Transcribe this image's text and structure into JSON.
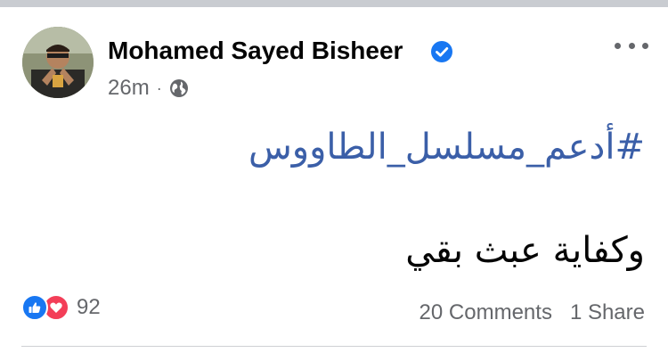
{
  "post": {
    "author": "Mohamed Sayed Bisheer",
    "time": "26m",
    "separator": "·",
    "privacy_icon": "globe-icon",
    "verified_icon": "verified-badge-icon",
    "hashtag": "#أدعم_مسلسل_الطاووس",
    "body_text": "وكفاية عبث بقي",
    "reactions": {
      "types": [
        "like",
        "love"
      ],
      "count": "92"
    },
    "comments": "20 Comments",
    "shares": "1 Share"
  },
  "colors": {
    "link": "#3b5fa8",
    "secondary_text": "#65676b",
    "like": "#1877f2",
    "love": "#f33e58",
    "verified": "#1877f2",
    "top_strip": "#c9ccd1"
  }
}
